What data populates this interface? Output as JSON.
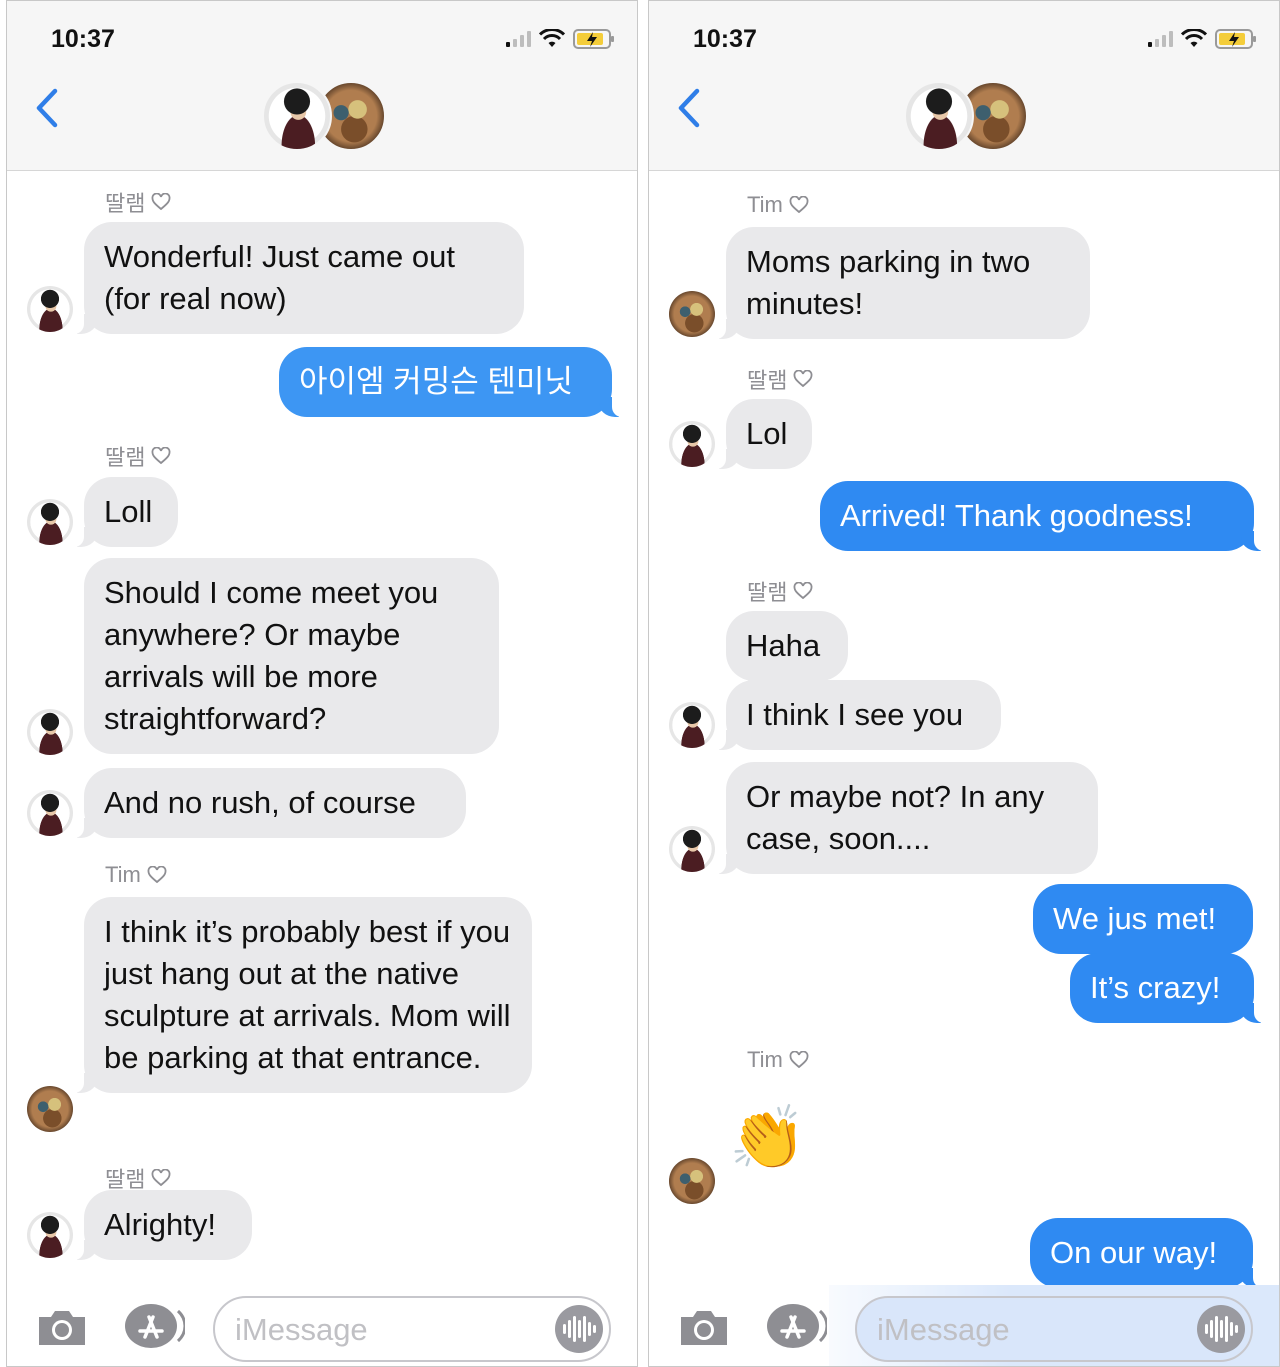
{
  "left": {
    "status": {
      "time": "10:37"
    },
    "messages": {
      "s1": "딸램",
      "m1": "Wonderful! Just came out (for real now)",
      "m2": "아이엠 커밍슨 텐미닛",
      "s2": "딸램",
      "m3": "Loll",
      "m4": "Should I come meet you anywhere? Or maybe arrivals will be more straightforward?",
      "m5": "And no rush, of course",
      "s3": "Tim",
      "m6": "I think it’s probably best if you just hang out at the native sculpture at arrivals. Mom will be parking at that entrance.",
      "s4": "딸램",
      "m7": "Alrighty!"
    },
    "input": {
      "placeholder": "iMessage"
    }
  },
  "right": {
    "status": {
      "time": "10:37"
    },
    "messages": {
      "s1": "Tim",
      "m1": "Moms parking in two minutes!",
      "s2": "딸램",
      "m2": "Lol",
      "m3": "Arrived! Thank goodness!",
      "s3": "딸램",
      "m4": "Haha",
      "m5": "I think I see you",
      "m6": "Or maybe not? In any case, soon....",
      "m7": "We jus met!",
      "m8": "It’s crazy!",
      "s4": "Tim",
      "emoji": "👏",
      "m9": "On our way!"
    },
    "input": {
      "placeholder": "iMessage"
    }
  },
  "colors": {
    "incoming_bubble": "#e9e9eb",
    "outgoing_bubble": "#3d96f3",
    "ios_blue": "#2f7ee8",
    "sender_gray": "#8e8e93"
  },
  "icons": {
    "back": "chevron-left-icon",
    "heart": "heart-icon",
    "camera": "camera-icon",
    "appstore": "app-store-icon",
    "audio": "audio-waveform-icon",
    "wifi": "wifi-icon",
    "battery": "battery-charging-icon",
    "signal": "cellular-signal-icon"
  }
}
